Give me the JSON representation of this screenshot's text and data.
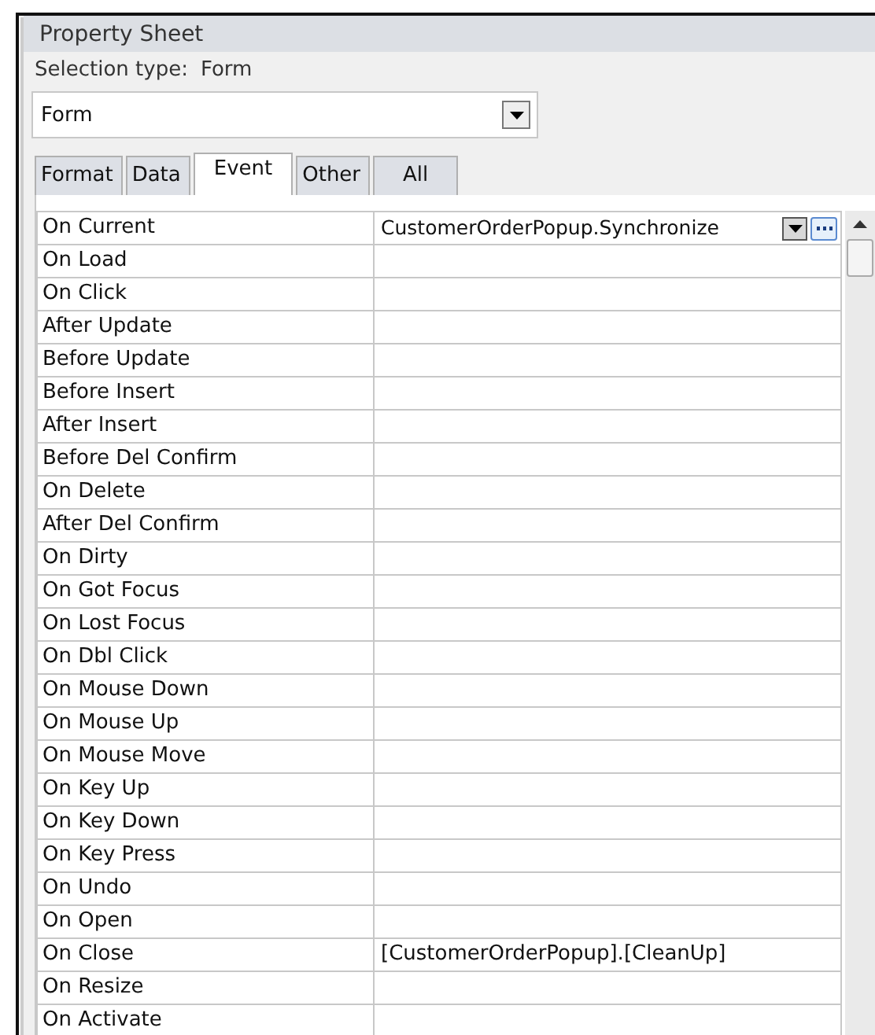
{
  "window": {
    "title": "Property Sheet"
  },
  "selection_type": {
    "label": "Selection type:",
    "value": "Form"
  },
  "object_dropdown": {
    "value": "Form"
  },
  "tabs": [
    {
      "label": "Format",
      "selected": false
    },
    {
      "label": "Data",
      "selected": false
    },
    {
      "label": "Event",
      "selected": true
    },
    {
      "label": "Other",
      "selected": false
    },
    {
      "label": "All",
      "selected": false
    }
  ],
  "properties": [
    {
      "name": "On Current",
      "value": "CustomerOrderPopup.Synchronize",
      "selected": true
    },
    {
      "name": "On Load",
      "selected": false
    },
    {
      "name": "On Click",
      "selected": false
    },
    {
      "name": "After Update",
      "selected": false
    },
    {
      "name": "Before Update",
      "selected": false
    },
    {
      "name": "Before Insert",
      "selected": false
    },
    {
      "name": "After Insert",
      "selected": false
    },
    {
      "name": "Before Del Confirm",
      "selected": false
    },
    {
      "name": "On Delete",
      "selected": false
    },
    {
      "name": "After Del Confirm",
      "selected": false
    },
    {
      "name": "On Dirty",
      "selected": false
    },
    {
      "name": "On Got Focus",
      "selected": false
    },
    {
      "name": "On Lost Focus",
      "selected": false
    },
    {
      "name": "On Dbl Click",
      "selected": false
    },
    {
      "name": "On Mouse Down",
      "selected": false
    },
    {
      "name": "On Mouse Up",
      "selected": false
    },
    {
      "name": "On Mouse Move",
      "selected": false
    },
    {
      "name": "On Key Up",
      "selected": false
    },
    {
      "name": "On Key Down",
      "selected": false
    },
    {
      "name": "On Key Press",
      "selected": false
    },
    {
      "name": "On Undo",
      "selected": false
    },
    {
      "name": "On Open",
      "selected": false
    },
    {
      "name": "On Close",
      "value": "[CustomerOrderPopup].[CleanUp]",
      "selected": false
    },
    {
      "name": "On Resize",
      "selected": false
    },
    {
      "name": "On Activate",
      "selected": false
    }
  ]
}
